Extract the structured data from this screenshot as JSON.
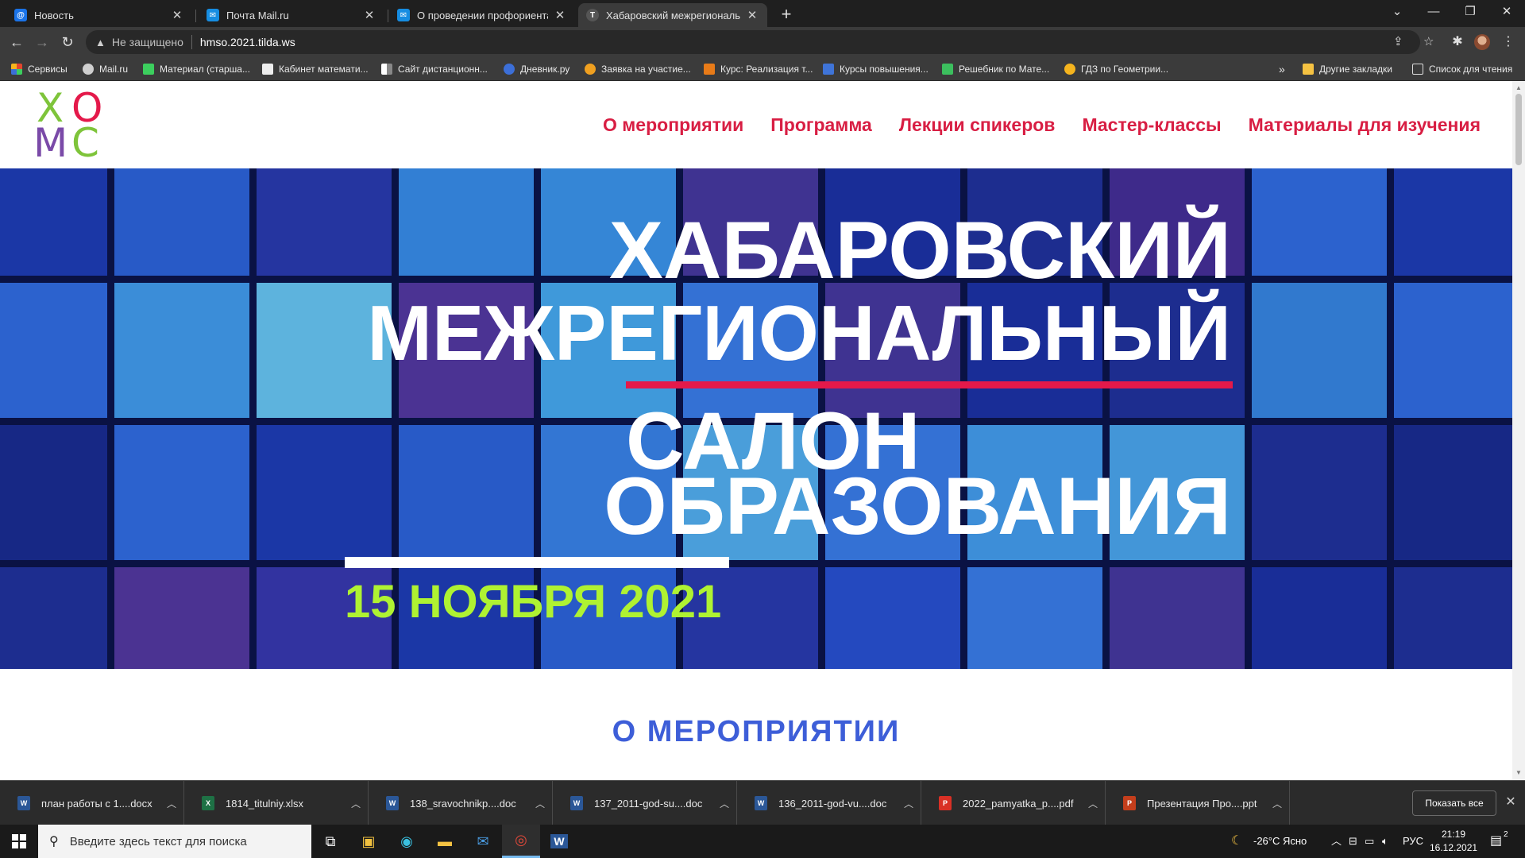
{
  "tabs": [
    {
      "title": "Новость",
      "favicon": "at-icon",
      "color": "#1a73e8"
    },
    {
      "title": "Почта Mail.ru",
      "favicon": "mail-icon",
      "color": "#168de2"
    },
    {
      "title": "О проведении профориентаци",
      "favicon": "mail-icon",
      "color": "#168de2"
    },
    {
      "title": "Хабаровский межрегиональны",
      "favicon": "tilda-icon",
      "color": "#555555"
    }
  ],
  "toolbar": {
    "security_label": "Не защищено",
    "url": "hmso.2021.tilda.ws"
  },
  "bookmarks": [
    {
      "label": "Сервисы",
      "color": "#e2462e"
    },
    {
      "label": "Mail.ru",
      "color": "#cfcfcf"
    },
    {
      "label": "Материал (старша...",
      "color": "#3ccf5e"
    },
    {
      "label": "Кабинет математи...",
      "color": "#eeeeee"
    },
    {
      "label": "Сайт дистанционн...",
      "color": "#cfcfcf"
    },
    {
      "label": "Дневник.ру",
      "color": "#3c6fd8"
    },
    {
      "label": "Заявка на участие...",
      "color": "#f0a020"
    },
    {
      "label": "Курс: Реализация т...",
      "color": "#e87b18"
    },
    {
      "label": "Курсы повышения...",
      "color": "#3f74d8"
    },
    {
      "label": "Решебник по Мате...",
      "color": "#3cbf5e"
    },
    {
      "label": "ГДЗ по Геометрии...",
      "color": "#f5b41e"
    }
  ],
  "bookmarks_right": {
    "more": "»",
    "other": "Другие закладки",
    "reading_list": "Список для чтения"
  },
  "site": {
    "logo": {
      "x": "Х",
      "o": "О",
      "m": "М",
      "c": "С"
    },
    "nav": [
      "О мероприятии",
      "Программа",
      "Лекции спикеров",
      "Мастер-классы",
      "Материалы для изучения"
    ],
    "hero": {
      "line1": "ХАБАРОВСКИЙ",
      "line2": "МЕЖРЕГИОНАЛЬНЫЙ",
      "line3": "САЛОН",
      "line4": "ОБРАЗОВАНИЯ",
      "date": "15 НОЯБРЯ 2021"
    },
    "section_title": "О МЕРОПРИЯТИИ"
  },
  "downloads": [
    {
      "name": "план работы с 1....docx",
      "type": "word"
    },
    {
      "name": "1814_titulniy.xlsx",
      "type": "excel"
    },
    {
      "name": "138_sravochnikp....doc",
      "type": "word"
    },
    {
      "name": "137_2011-god-su....doc",
      "type": "word"
    },
    {
      "name": "136_2011-god-vu....doc",
      "type": "word"
    },
    {
      "name": "2022_pamyatka_p....pdf",
      "type": "pdf"
    },
    {
      "name": "Презентация Про....ppt",
      "type": "ppt"
    }
  ],
  "downloads_show_all": "Показать все",
  "taskbar": {
    "search_placeholder": "Введите здесь текст для поиска",
    "weather": "-26°C  Ясно",
    "language": "РУС",
    "time": "21:19",
    "date": "16.12.2021",
    "notifications": "2"
  },
  "colors": {
    "accent_red": "#d81e43",
    "date_green": "#aff232",
    "section_blue": "#3d5ed8"
  }
}
